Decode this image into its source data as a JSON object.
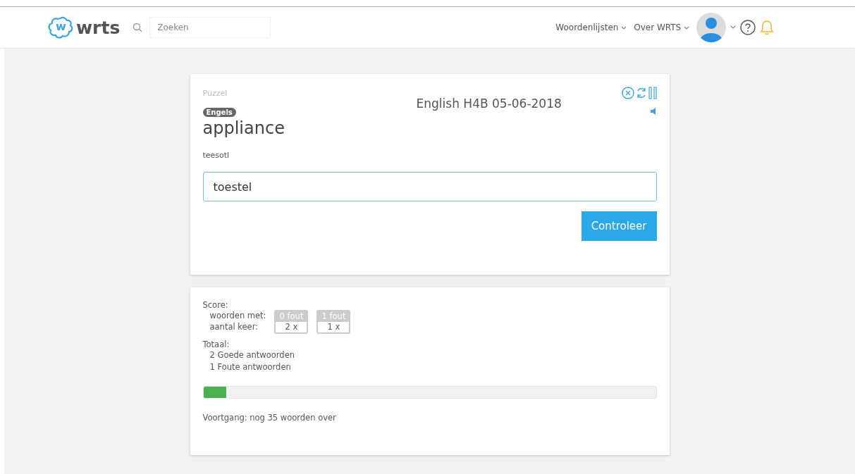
{
  "header": {
    "logo_letter": "w",
    "logo_text": "wrts",
    "search": {
      "placeholder": "Zoeken"
    },
    "nav": [
      "Woordenlijsten",
      "Over WRTS"
    ]
  },
  "quiz": {
    "mode": "Puzzel",
    "list_title": "English H4B 05-06-2018",
    "language": "Engels",
    "word": "appliance",
    "hint": "teesotl",
    "answer": "toestel",
    "submit": "Controleer"
  },
  "score": {
    "title": "Score:",
    "row_labels": [
      "woorden met:",
      "aantal keer:"
    ],
    "columns": [
      {
        "header": "0 fout",
        "value": "2 x"
      },
      {
        "header": "1 fout",
        "value": "1 x"
      }
    ],
    "total_title": "Totaal:",
    "totals": [
      "2 Goede antwoorden",
      "1 Foute antwoorden"
    ],
    "progress": {
      "level": 0.05
    },
    "progress_text": "Voortgang: nog 35 woorden over"
  }
}
